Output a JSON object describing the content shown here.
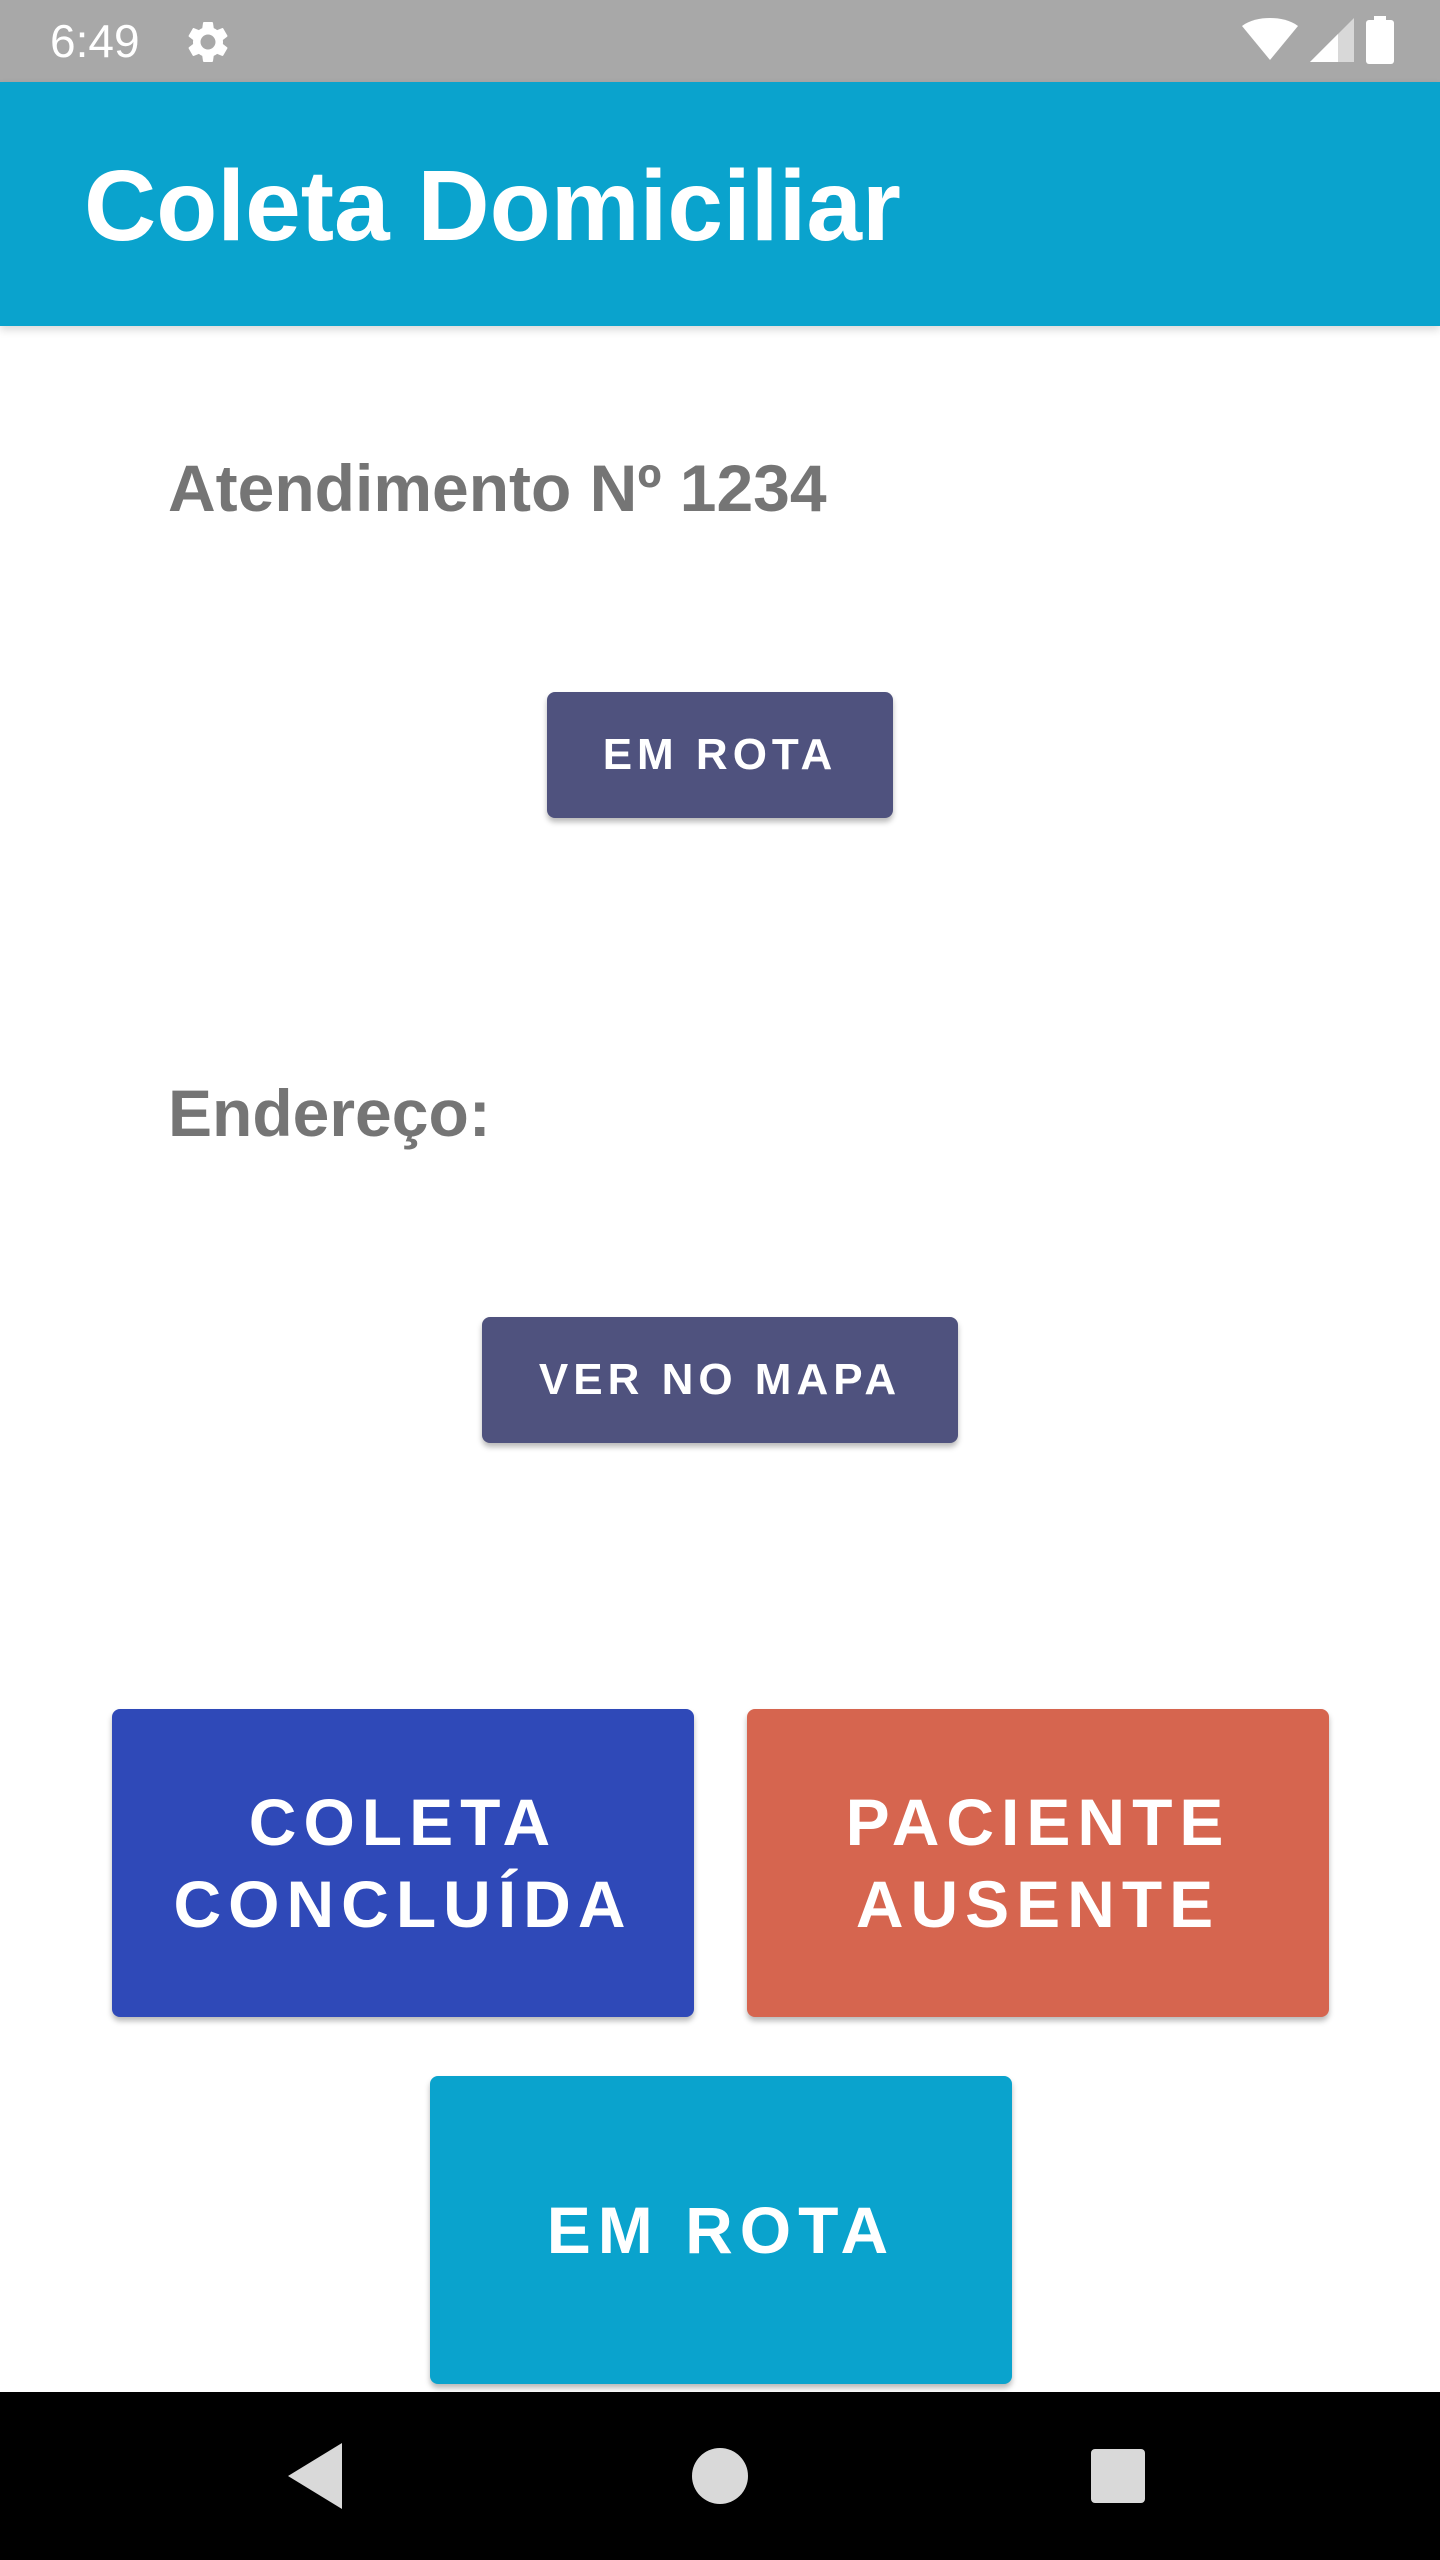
{
  "status_bar": {
    "time": "6:49",
    "icons": [
      "settings-gear-icon",
      "wifi-icon",
      "signal-icon",
      "battery-icon"
    ]
  },
  "app_bar": {
    "title": "Coleta Domiciliar",
    "background": "#0aa3cd"
  },
  "main": {
    "attendance_label": "Atendimento Nº 1234",
    "status_button_label": "EM ROTA",
    "address_label": "Endereço:",
    "map_button_label": "VER NO MAPA"
  },
  "actions": {
    "completed_label": "COLETA\nCONCLUÍDA",
    "absent_label": "PACIENTE\nAUSENTE",
    "en_route_label": "EM ROTA"
  },
  "colors": {
    "primary": "#0aa3cd",
    "small_button": "#4f527e",
    "completed_button": "#2f49b8",
    "absent_button": "#d6654f",
    "label_text": "#757575"
  },
  "nav_bar": {
    "icons": [
      "back-icon",
      "home-icon",
      "recents-icon"
    ]
  }
}
